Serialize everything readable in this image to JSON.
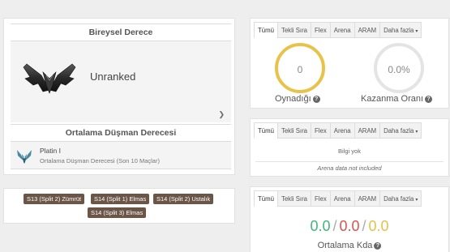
{
  "rank": {
    "title": "Bireysel Derece",
    "tier": "Unranked",
    "enemy_title": "Ortalama Düşman Derecesi",
    "enemy_rank": "Platin I",
    "enemy_sub": "Ortalama Düşman Derecesi (Son 10 Maçlar)"
  },
  "badges": [
    "S13 (Split 2) Zümrüt",
    "S14 (Split 1) Elmas",
    "S14 (Split 2) Ustalık",
    "S14 (Split 3) Elmas"
  ],
  "tabs": [
    "Tümü",
    "Tekli Sıra",
    "Flex",
    "Arena",
    "ARAM",
    "Daha fazla"
  ],
  "winrate": {
    "played_value": "0",
    "played_label": "Oynadığı",
    "winrate_value": "0.0%",
    "winrate_label": "Kazanma Oranı"
  },
  "nodata": {
    "text": "Bilgi yok",
    "subtext": "Arena data not included"
  },
  "kda": {
    "kills": "0.0",
    "deaths": "0.0",
    "assists": "0.0",
    "separator": "/",
    "label": "Ortalama Kda"
  },
  "colors": {
    "played_ring": "#e8c34a",
    "winrate_ring": "#e4e4e4",
    "kills": "#3fb67a",
    "deaths": "#d9534f",
    "assists": "#e6c04a",
    "badge_bg": "#6b5546"
  }
}
